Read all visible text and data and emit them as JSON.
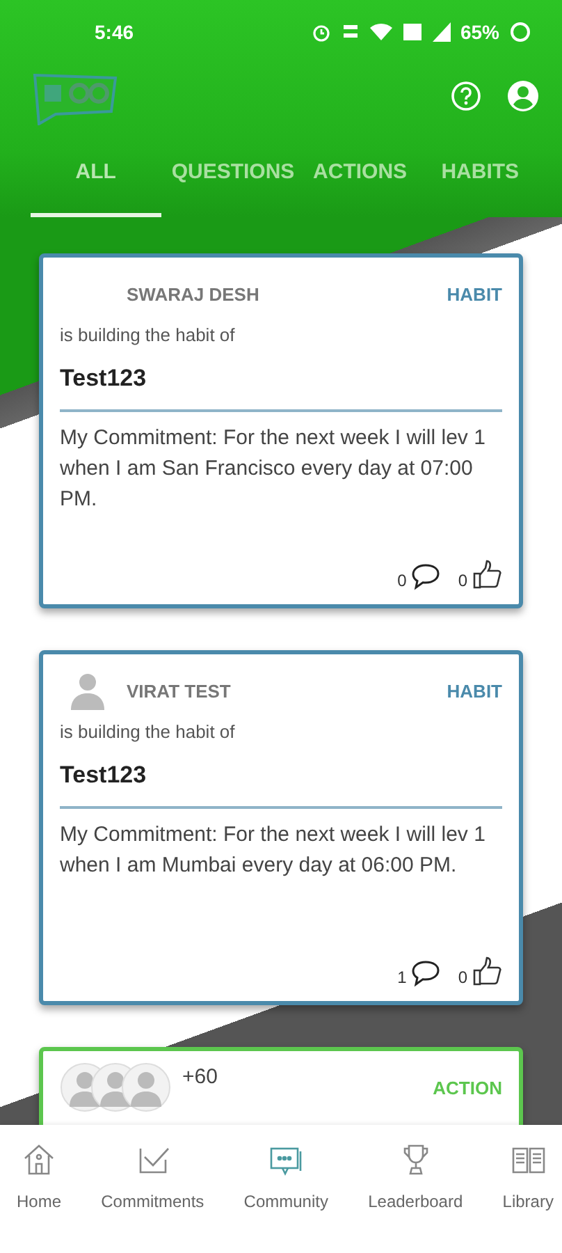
{
  "status_bar": {
    "time": "5:46",
    "battery": "65%"
  },
  "tabs": [
    {
      "label": "ALL",
      "selected": true
    },
    {
      "label": "QUESTIONS",
      "selected": false
    },
    {
      "label": "ACTIONS",
      "selected": false
    },
    {
      "label": "HABITS",
      "selected": false
    }
  ],
  "feed": [
    {
      "kind": "habit",
      "avatar": false,
      "name": "SWARAJ DESH",
      "tag": "HABIT",
      "intro": "is building the habit of",
      "title": "Test123",
      "commitment": "My Commitment: For the next week I will lev 1 when I am San Francisco every day at 07:00 PM.",
      "comments": "0",
      "likes": "0"
    },
    {
      "kind": "habit",
      "avatar": true,
      "name": "VIRAT TEST",
      "tag": "HABIT",
      "intro": "is building the habit of",
      "title": "Test123",
      "commitment": "My Commitment: For the next week I will lev 1 when I am Mumbai every day at 06:00 PM.",
      "comments": "1",
      "likes": "0"
    },
    {
      "kind": "action",
      "extra": "+60",
      "tag": "ACTION"
    }
  ],
  "bottom_nav": [
    {
      "label": "Home",
      "kind": "home",
      "selected": false
    },
    {
      "label": "Commitments",
      "kind": "check",
      "selected": false
    },
    {
      "label": "Community",
      "kind": "chat",
      "selected": true
    },
    {
      "label": "Leaderboard",
      "kind": "trophy",
      "selected": false
    },
    {
      "label": "Library",
      "kind": "book",
      "selected": false
    }
  ]
}
